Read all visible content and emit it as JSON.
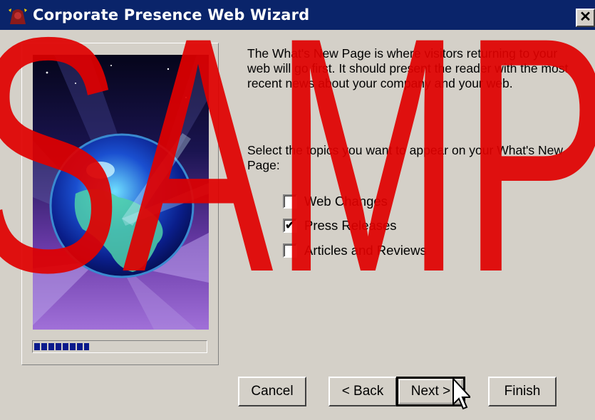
{
  "window": {
    "title": "Corporate Presence Web Wizard",
    "close_glyph": "✕",
    "icon": "wizard-app-icon"
  },
  "content": {
    "description": "The What's New Page is where visitors returning to your web will go first. It should present the reader with the most recent news about your company and your web.",
    "instruction": "Select the topics you want to appear on your What's New Page:",
    "checkboxes": [
      {
        "label": "Web Changes",
        "checked": false
      },
      {
        "label": "Press Releases",
        "checked": true
      },
      {
        "label": "Articles and Reviews",
        "checked": false
      }
    ],
    "check_glyph": "✔"
  },
  "progress": {
    "segments": 7,
    "fraction": 0.32
  },
  "buttons": {
    "cancel": "Cancel",
    "back": "< Back",
    "next": "Next >",
    "finish": "Finish"
  },
  "watermark": {
    "text": "SAMP",
    "color": "#e00000"
  },
  "colors": {
    "titlebar": "#0a246a",
    "face": "#d4d0c8",
    "progress": "#0a1a8c"
  }
}
